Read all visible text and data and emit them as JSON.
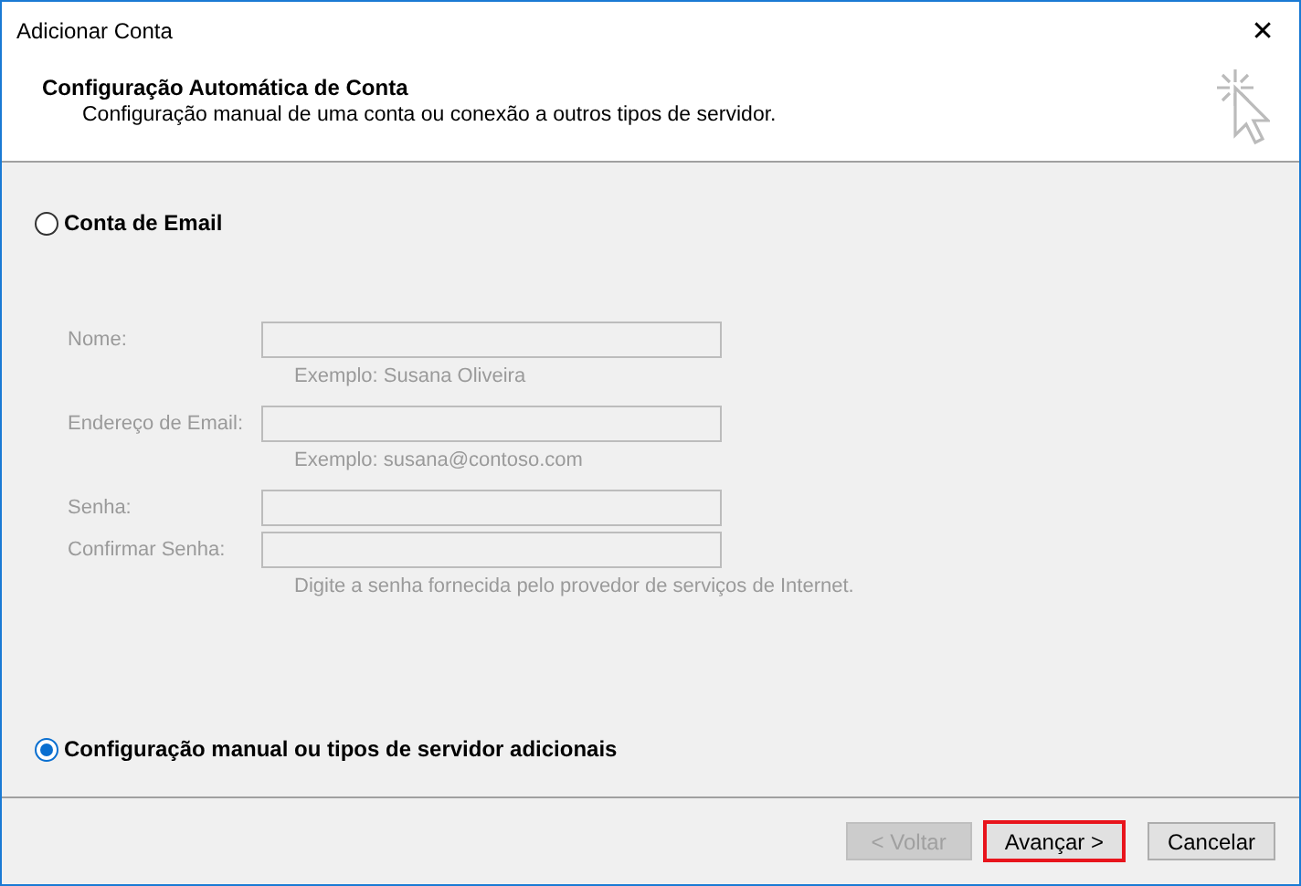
{
  "window": {
    "title": "Adicionar Conta",
    "close": "✕"
  },
  "header": {
    "title": "Configuração Automática de Conta",
    "subtitle": "Configuração manual de uma conta ou conexão a outros tipos de servidor."
  },
  "options": [
    {
      "label": "Conta de Email",
      "selected": false
    },
    {
      "label": "Configuração manual ou tipos de servidor adicionais",
      "selected": true
    }
  ],
  "fields": [
    {
      "label": "Nome:",
      "disabled": true,
      "hint": "Exemplo: Susana Oliveira"
    },
    {
      "label": "Endereço de Email:",
      "disabled": true,
      "hint": "Exemplo: susana@contoso.com"
    },
    {
      "label": "Senha:",
      "disabled": true
    },
    {
      "label": "Confirmar Senha:",
      "disabled": true,
      "hint": "Digite a senha fornecida pelo provedor de serviços de Internet."
    }
  ],
  "buttons": [
    {
      "label": "< Voltar",
      "disabled": true,
      "highlighted": false
    },
    {
      "label": "Avançar >",
      "disabled": false,
      "highlighted": true
    },
    {
      "label": "Cancelar",
      "disabled": false,
      "highlighted": false
    }
  ]
}
